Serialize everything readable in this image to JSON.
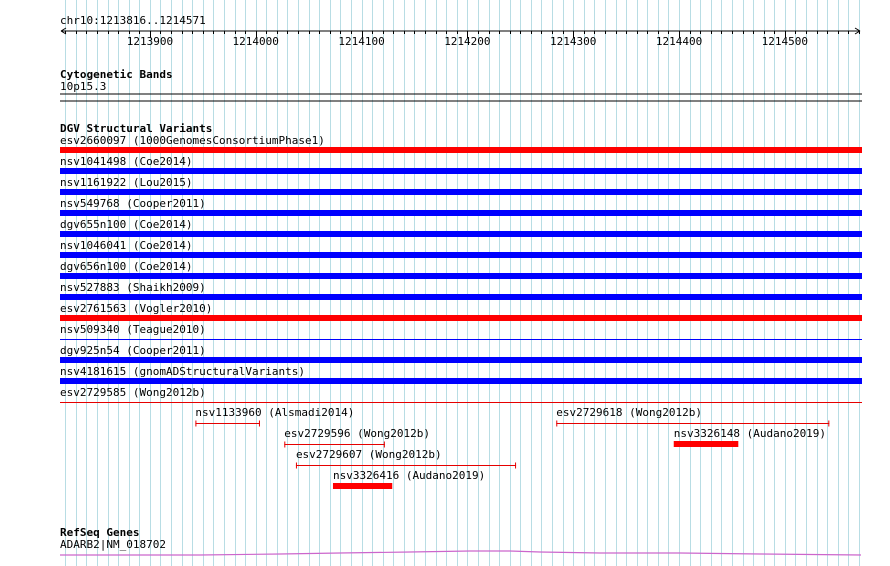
{
  "ruler": {
    "coordinates": "chr10:1213816..1214571",
    "start": 1213816,
    "end": 1214571,
    "ticks": [
      1213900,
      1214000,
      1214100,
      1214200,
      1214300,
      1214400,
      1214500
    ],
    "tick_labels": [
      "1213900",
      "1214000",
      "1214100",
      "1214200",
      "1214300",
      "1214400",
      "1214500"
    ]
  },
  "colors": {
    "grid": "#b8dde4",
    "red": "#ff0000",
    "blue": "#0000ff",
    "red_thin": "#e60000",
    "gene": "#cc66cc",
    "separator": "#000000"
  },
  "tracks": {
    "cytobands": {
      "title": "Cytogenetic Bands",
      "feature_label": "10p15.3"
    },
    "dgv": {
      "title": "DGV Structural Variants",
      "full_span_features": [
        {
          "label": "esv2660097 (1000GenomesConsortiumPhase1)",
          "color": "red"
        },
        {
          "label": "nsv1041498 (Coe2014)",
          "color": "blue"
        },
        {
          "label": "nsv1161922 (Lou2015)",
          "color": "blue"
        },
        {
          "label": "nsv549768 (Cooper2011)",
          "color": "blue"
        },
        {
          "label": "dgv655n100 (Coe2014)",
          "color": "blue"
        },
        {
          "label": "nsv1046041 (Coe2014)",
          "color": "blue"
        },
        {
          "label": "dgv656n100 (Coe2014)",
          "color": "blue"
        },
        {
          "label": "nsv527883 (Shaikh2009)",
          "color": "blue"
        },
        {
          "label": "esv2761563 (Vogler2010)",
          "color": "red"
        },
        {
          "label": "nsv509340 (Teague2010)",
          "color": "blue_thin"
        },
        {
          "label": "dgv925n54 (Cooper2011)",
          "color": "blue"
        },
        {
          "label": "nsv4181615 (gnomADStructuralVariants)",
          "color": "blue"
        },
        {
          "label": "esv2729585 (Wong2012b)",
          "color": "red_thin"
        }
      ],
      "partial_features": [
        {
          "label": "nsv1133960 (Alsmadi2014)",
          "start": 1213943,
          "end": 1214004,
          "style": "thin",
          "row": 0
        },
        {
          "label": "esv2729618 (Wong2012b)",
          "start": 1214284,
          "end": 1214542,
          "style": "thin",
          "row": 0
        },
        {
          "label": "esv2729596 (Wong2012b)",
          "start": 1214027,
          "end": 1214122,
          "style": "thin",
          "row": 1
        },
        {
          "label": "nsv3326148 (Audano2019)",
          "start": 1214395,
          "end": 1214456,
          "style": "thick",
          "row": 1
        },
        {
          "label": "esv2729607 (Wong2012b)",
          "start": 1214038,
          "end": 1214246,
          "style": "thin",
          "row": 2
        },
        {
          "label": "nsv3326416 (Audano2019)",
          "start": 1214073,
          "end": 1214129,
          "style": "thick",
          "row": 3
        }
      ]
    },
    "refseq": {
      "title": "RefSeq Genes",
      "feature_label": "ADARB2|NM_018702"
    }
  }
}
